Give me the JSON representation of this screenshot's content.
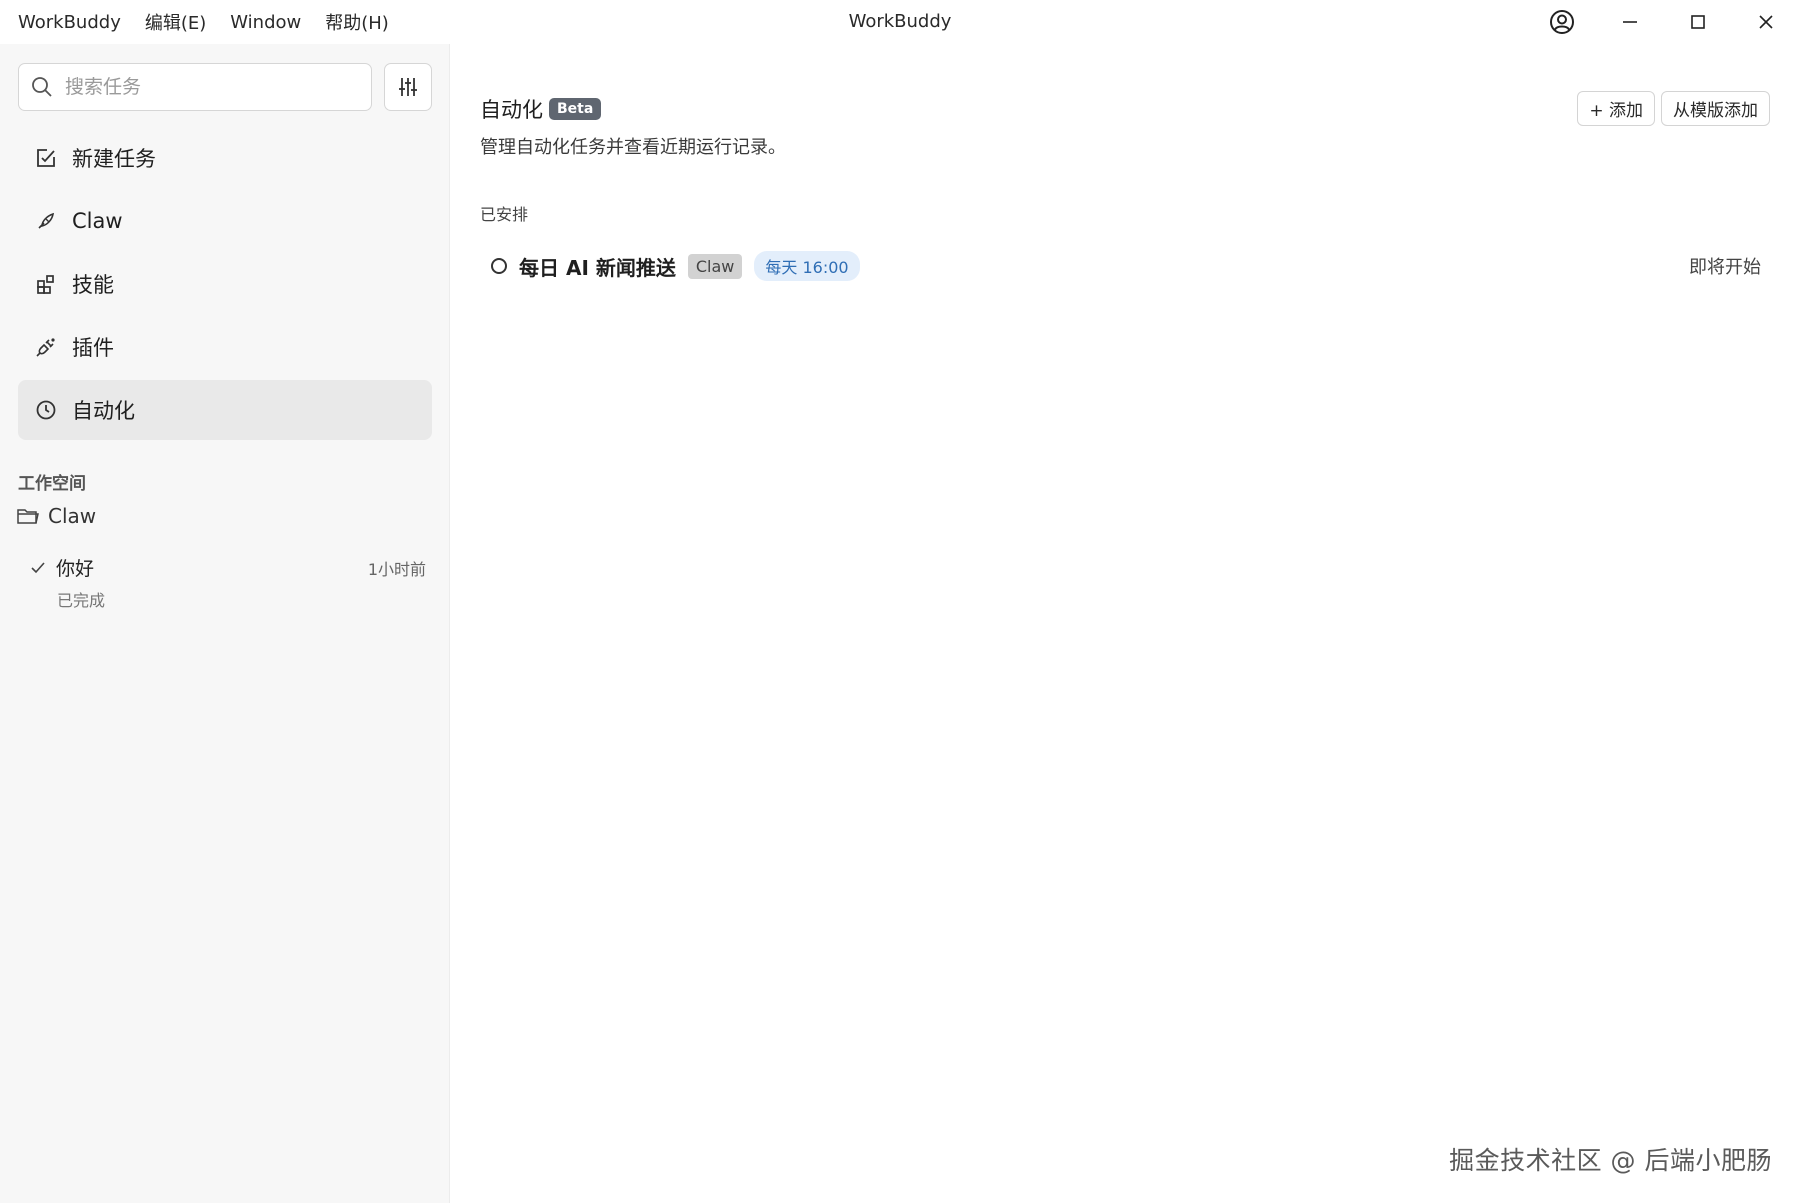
{
  "app_title": "WorkBuddy",
  "menu": {
    "app": "WorkBuddy",
    "edit": "编辑(E)",
    "window": "Window",
    "help": "帮助(H)"
  },
  "sidebar": {
    "search_placeholder": "搜索任务",
    "nav": [
      {
        "label": "新建任务",
        "icon": "checkbox-edit-icon"
      },
      {
        "label": "Claw",
        "icon": "claw-icon"
      },
      {
        "label": "技能",
        "icon": "skills-blocks-icon"
      },
      {
        "label": "插件",
        "icon": "plugin-plug-icon"
      },
      {
        "label": "自动化",
        "icon": "clock-icon",
        "active": true
      }
    ],
    "workspace_heading": "工作空间",
    "workspace_folder": "Claw",
    "tasks": [
      {
        "name": "你好",
        "time": "1小时前",
        "status": "已完成"
      }
    ]
  },
  "main": {
    "title": "自动化",
    "badge": "Beta",
    "subtitle": "管理自动化任务并查看近期运行记录。",
    "add_button": "+ 添加",
    "template_button": "从模版添加",
    "section_scheduled": "已安排",
    "automations": [
      {
        "name": "每日 AI 新闻推送",
        "tag": "Claw",
        "schedule": "每天 16:00",
        "state": "即将开始"
      }
    ]
  },
  "watermark": "掘金技术社区 @ 后端小肥肠",
  "colors": {
    "sidebar_bg": "#f7f7f7",
    "active_nav_bg": "#e9e9e9",
    "badge_bg": "#5f6670",
    "schedule_tag_bg": "#e3eefb",
    "schedule_tag_text": "#2f6eb5"
  }
}
